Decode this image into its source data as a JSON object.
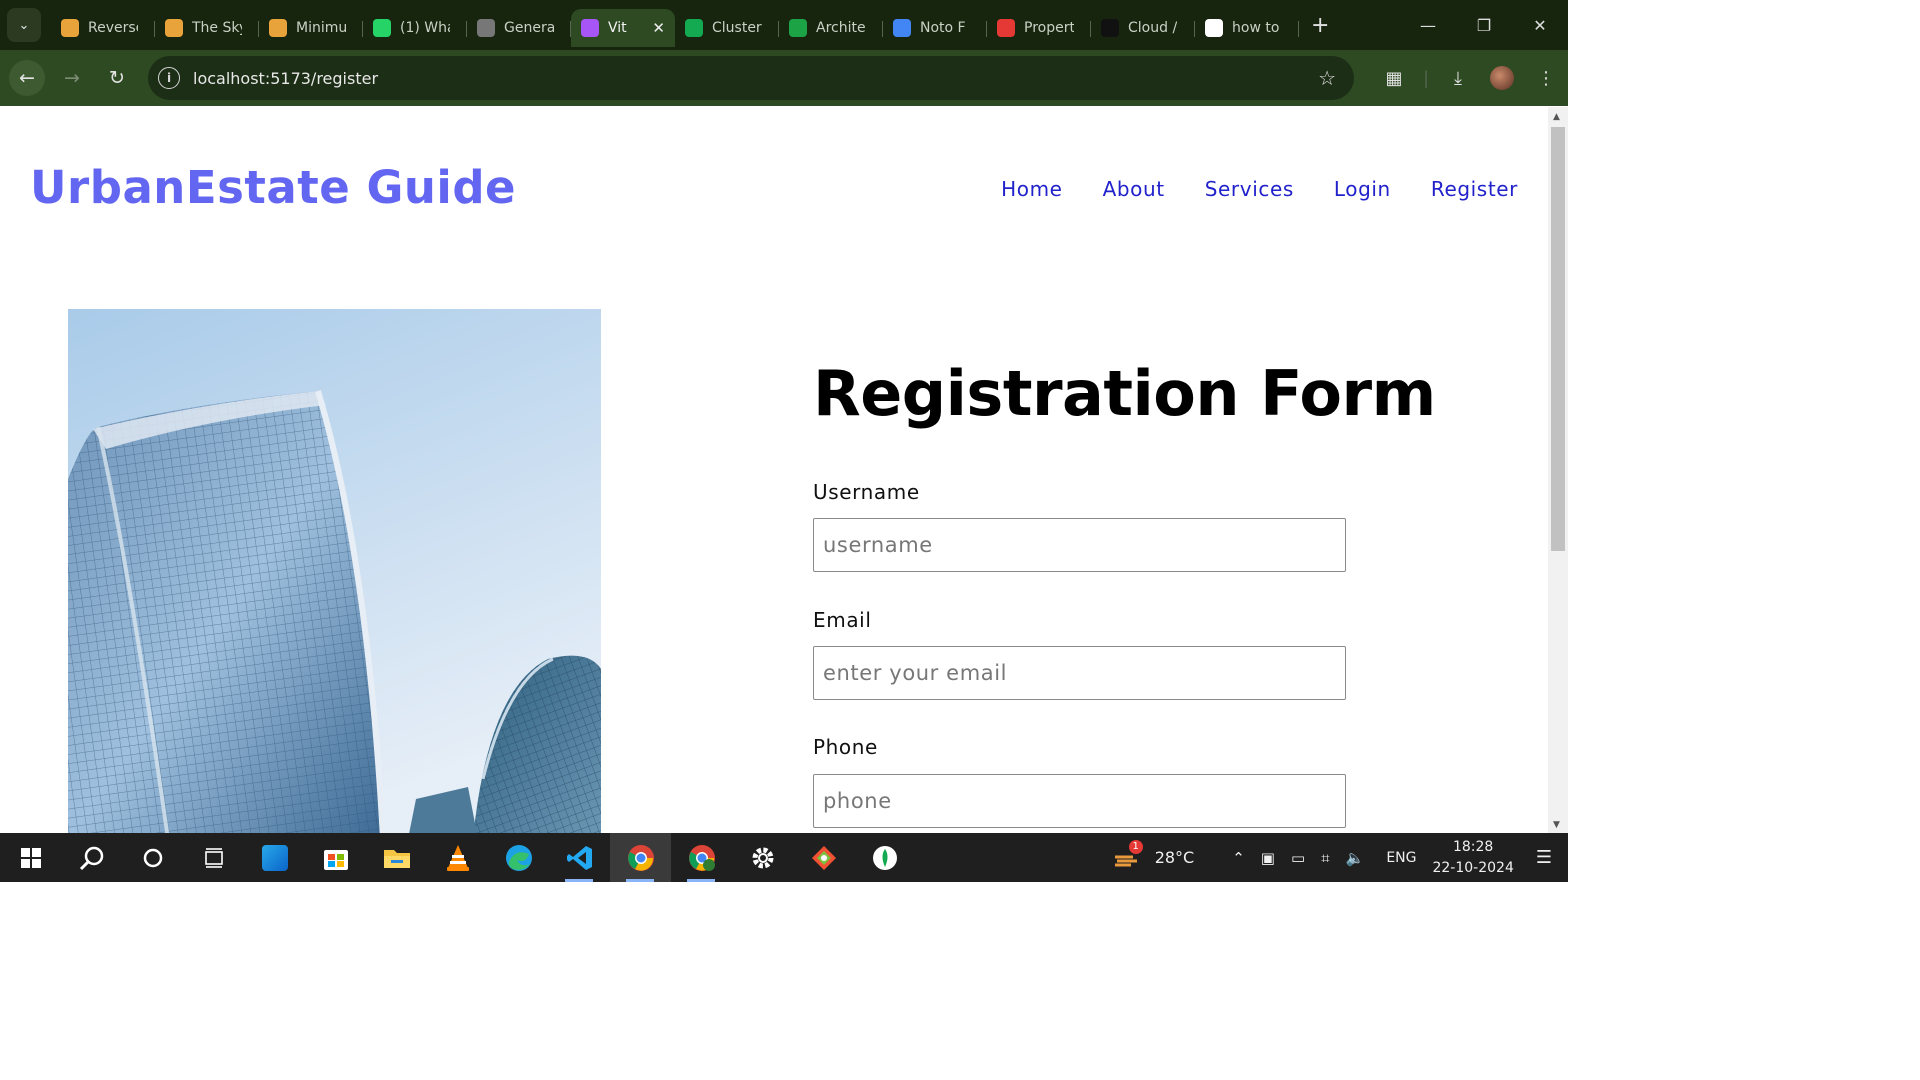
{
  "browser": {
    "tabs": [
      {
        "title": "Reverse",
        "favicon": "stacked-arrows-icon",
        "color": "#e8a33a"
      },
      {
        "title": "The Sky",
        "favicon": "stacked-arrows-icon",
        "color": "#e8a33a"
      },
      {
        "title": "Minimu",
        "favicon": "stacked-arrows-icon",
        "color": "#e8a33a"
      },
      {
        "title": "(1) Wha",
        "favicon": "whatsapp-icon",
        "color": "#25d366"
      },
      {
        "title": "Genera",
        "favicon": "globe-icon",
        "color": "#777777"
      },
      {
        "title": "Vit",
        "favicon": "vite-icon",
        "color": "#a855f7",
        "active": true
      },
      {
        "title": "Cluster",
        "favicon": "mongodb-leaf-icon",
        "color": "#13aa52"
      },
      {
        "title": "Archite",
        "favicon": "px-icon",
        "color": "#1ba346"
      },
      {
        "title": "Noto F",
        "favicon": "noto-icon",
        "color": "#4285f4"
      },
      {
        "title": "Propert",
        "favicon": "heart-icon",
        "color": "#e53935"
      },
      {
        "title": "Cloud /",
        "favicon": "cloud-icon",
        "color": "#111111"
      },
      {
        "title": "how to",
        "favicon": "google-icon",
        "color": "#ffffff"
      }
    ],
    "url": "localhost:5173/register"
  },
  "site": {
    "logo": "UrbanEstate Guide",
    "nav": [
      "Home",
      "About",
      "Services",
      "Login",
      "Register"
    ]
  },
  "form": {
    "title": "Registration Form",
    "fields": [
      {
        "label": "Username",
        "placeholder": "username",
        "value": ""
      },
      {
        "label": "Email",
        "placeholder": "enter your email",
        "value": ""
      },
      {
        "label": "Phone",
        "placeholder": "phone",
        "value": ""
      }
    ]
  },
  "taskbar": {
    "weather": "28°C",
    "weather_badge": "1",
    "language": "ENG",
    "time": "18:28",
    "date": "22-10-2024"
  },
  "colors": {
    "brand": "#6366f1",
    "nav_link": "#2222cc",
    "chrome_bg": "#17250f"
  }
}
